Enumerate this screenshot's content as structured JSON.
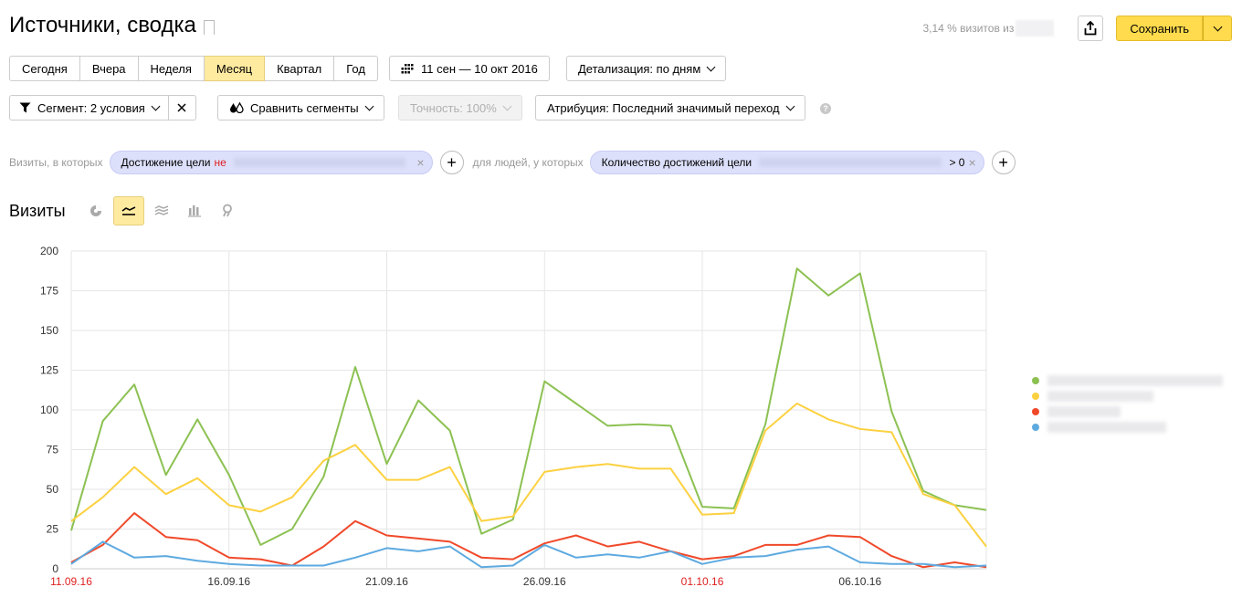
{
  "header": {
    "title": "Источники, сводка",
    "visit_share": "3,14 % визитов из",
    "save_label": "Сохранить"
  },
  "periods": [
    "Сегодня",
    "Вчера",
    "Неделя",
    "Месяц",
    "Квартал",
    "Год"
  ],
  "active_period": "Месяц",
  "date_range": "11 сен — 10 окт 2016",
  "detail": "Детализация: по дням",
  "segment": "Сегмент: 2 условия",
  "compare": "Сравнить сегменты",
  "accuracy": "Точность: 100%",
  "attribution": "Атрибуция: Последний значимый переход",
  "filters": {
    "visits_label": "Визиты, в которых",
    "goal_label": "Достижение цели",
    "goal_neg": "не",
    "people_label": "для людей, у которых",
    "count_label": "Количество достижений цели",
    "count_cond": "> 0"
  },
  "section_title": "Визиты",
  "chart_data": {
    "type": "line",
    "ylim": [
      0,
      200
    ],
    "yticks": [
      0,
      25,
      50,
      75,
      100,
      125,
      150,
      175,
      200
    ],
    "xtick_labels": [
      {
        "i": 0,
        "label": "11.09.16",
        "holiday": true
      },
      {
        "i": 5,
        "label": "16.09.16",
        "holiday": false
      },
      {
        "i": 10,
        "label": "21.09.16",
        "holiday": false
      },
      {
        "i": 15,
        "label": "26.09.16",
        "holiday": false
      },
      {
        "i": 20,
        "label": "01.10.16",
        "holiday": true
      },
      {
        "i": 25,
        "label": "06.10.16",
        "holiday": false
      }
    ],
    "grid": true,
    "legend": "right",
    "series": [
      {
        "color": "#8cc152",
        "values": [
          24,
          93,
          116,
          59,
          94,
          59,
          15,
          25,
          58,
          127,
          66,
          106,
          87,
          22,
          31,
          118,
          104,
          90,
          91,
          90,
          39,
          38,
          91,
          189,
          172,
          186,
          99,
          49,
          40,
          37
        ]
      },
      {
        "color": "#fcd141",
        "values": [
          30,
          45,
          64,
          47,
          57,
          40,
          36,
          45,
          68,
          78,
          56,
          56,
          64,
          30,
          33,
          61,
          64,
          66,
          63,
          63,
          34,
          35,
          87,
          104,
          94,
          88,
          86,
          47,
          40,
          14
        ]
      },
      {
        "color": "#f0492a",
        "values": [
          4,
          15,
          35,
          20,
          18,
          7,
          6,
          2,
          14,
          30,
          21,
          19,
          17,
          7,
          6,
          16,
          21,
          14,
          17,
          11,
          6,
          8,
          15,
          15,
          21,
          20,
          8,
          1,
          4,
          1
        ]
      },
      {
        "color": "#5eaae0",
        "values": [
          3,
          17,
          7,
          8,
          5,
          3,
          2,
          2,
          2,
          7,
          13,
          11,
          14,
          1,
          2,
          15,
          7,
          9,
          7,
          11,
          3,
          7,
          8,
          12,
          14,
          4,
          3,
          3,
          1,
          2
        ]
      }
    ]
  }
}
